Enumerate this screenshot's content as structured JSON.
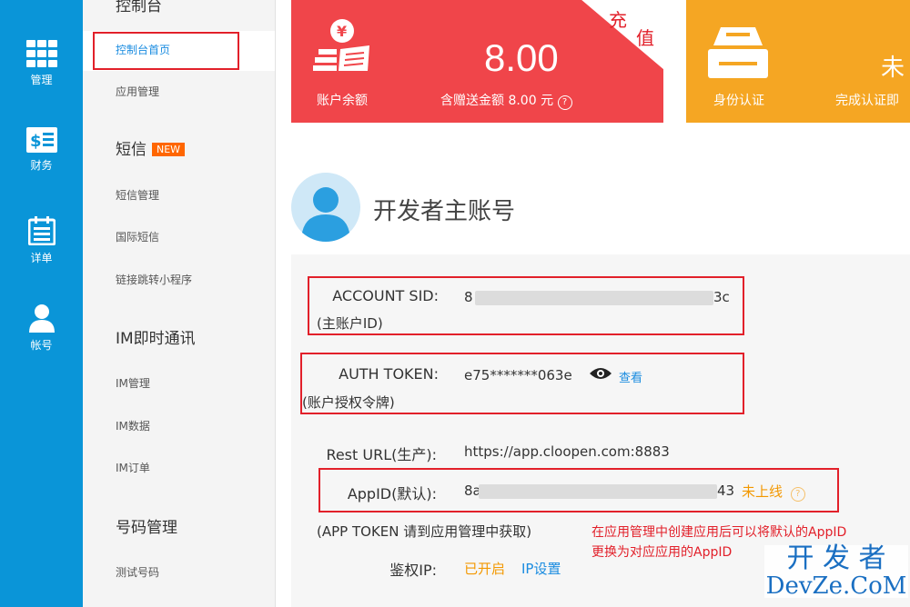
{
  "rail": {
    "items": [
      {
        "label": "管理",
        "icon": "grid-icon",
        "active": true
      },
      {
        "label": "财务",
        "icon": "money-list-icon",
        "active": false
      },
      {
        "label": "详单",
        "icon": "calendar-list-icon",
        "active": false
      },
      {
        "label": "帐号",
        "icon": "user-icon",
        "active": false
      }
    ]
  },
  "nav": {
    "top_group": "控制台",
    "items_console": [
      "控制台首页",
      "应用管理"
    ],
    "sms_group": "短信",
    "sms_badge": "NEW",
    "items_sms": [
      "短信管理",
      "国际短信",
      "链接跳转小程序"
    ],
    "im_group": "IM即时通讯",
    "items_im": [
      "IM管理",
      "IM数据",
      "IM订单"
    ],
    "number_group": "号码管理",
    "items_number": [
      "测试号码"
    ]
  },
  "balance_card": {
    "label": "账户余额",
    "amount": "8.00",
    "gift_text": "含赠送金额 8.00 元",
    "corner_1": "充",
    "corner_2": "值"
  },
  "verify_card": {
    "label": "身份认证",
    "status": "未",
    "desc": "完成认证即"
  },
  "profile": {
    "title": "开发者主账号"
  },
  "account": {
    "sid_label": "ACCOUNT SID:",
    "sid_sub": "(主账户ID)",
    "sid_prefix": "8",
    "sid_suffix": "3c",
    "token_label": "AUTH TOKEN:",
    "token_sub": "(账户授权令牌)",
    "token_value": "e75*******063e",
    "token_view": "查看",
    "rest_label": "Rest URL(生产):",
    "rest_value": "https://app.cloopen.com:8883",
    "appid_label": "AppID(默认):",
    "appid_prefix": "8a",
    "appid_suffix": "43",
    "appid_status": "未上线",
    "app_token_note": "(APP TOKEN 请到应用管理中获取)",
    "ip_label": "鉴权IP:",
    "ip_status": "已开启",
    "ip_link": "IP设置",
    "annotation_line1": "在应用管理中创建应用后可以将默认的AppID",
    "annotation_line2": "更换为对应应用的AppID"
  },
  "watermark": {
    "line1": "开 发 者",
    "line2": "DevZe.CoM"
  },
  "colors": {
    "rail": "#0a95d8",
    "balance_card": "#f0454a",
    "verify_card": "#f5a623",
    "highlight_box": "#e2202a",
    "link": "#1a8ce0",
    "status_orange": "#f39800"
  }
}
